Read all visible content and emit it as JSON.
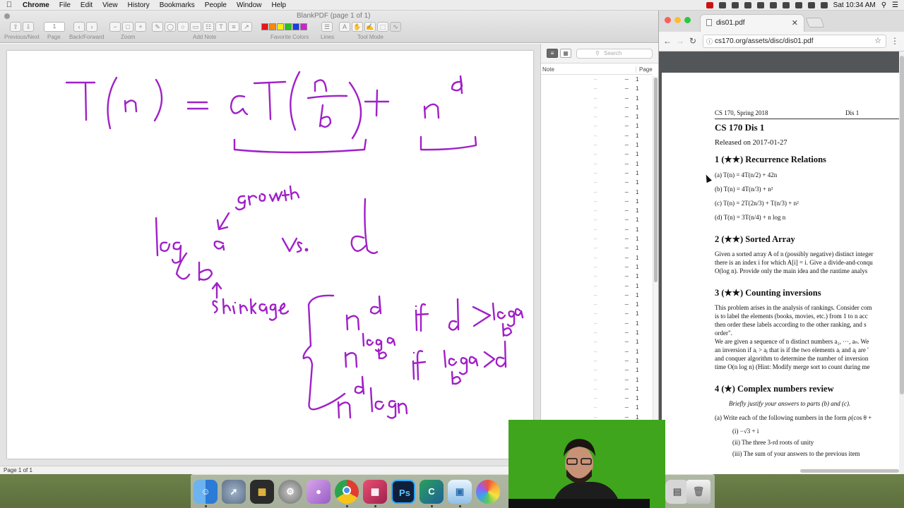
{
  "menubar": {
    "app": "Chrome",
    "items": [
      "File",
      "Edit",
      "View",
      "History",
      "Bookmarks",
      "People",
      "Window",
      "Help"
    ],
    "clock": "Sat 10:34 AM"
  },
  "preview": {
    "window_title": "BlankPDF (page 1 of 1)",
    "page_number": "1",
    "labels": {
      "prev_next": "Previous/Next",
      "page": "Page",
      "back_forward": "Back/Forward",
      "zoom": "Zoom",
      "add_note": "Add Note",
      "favorite_colors": "Favorite Colors",
      "lines": "Lines",
      "tool_mode": "Tool Mode"
    },
    "favorite_colors": [
      "#e8151b",
      "#ef8a13",
      "#f5ee16",
      "#26c124",
      "#1b3fe0",
      "#d21fd2"
    ],
    "status": "Page 1 of 1",
    "ink_color": "#a020c8"
  },
  "notes": {
    "search_placeholder": "Search",
    "col_note": "Note",
    "col_page": "Page",
    "row_page": "1"
  },
  "chrome": {
    "tab_title": "dis01.pdf",
    "url": "cs170.org/assets/disc/dis01.pdf"
  },
  "pdf": {
    "header_left": "CS 170, Spring 2018",
    "header_right": "Dis 1",
    "title": "CS 170 Dis 1",
    "released": "Released on 2017-01-27",
    "sec1": "1   (★★) Recurrence Relations",
    "sec1_items": [
      "(a)  T(n) = 4T(n/2) + 42n",
      "(b)  T(n) = 4T(n/3) + n²",
      "(c)  T(n) = 2T(2n/3) + T(n/3) + n²",
      "(d)  T(n) = 3T(n/4) + n log n"
    ],
    "sec2": "2   (★★) Sorted Array",
    "sec2_body": [
      "Given a sorted array A of n (possibly negative) distinct integer",
      "there is an index i for which A[i] = i. Give a divide-and-conqu",
      "O(log n). Provide only the main idea and the runtime analys"
    ],
    "sec3": "3   (★★) Counting inversions",
    "sec3_body": [
      "This problem arises in the analysis of rankings. Consider com",
      "is to label the elements (books, movies, etc.) from 1 to n acc",
      "then order these labels according to the other ranking, and s",
      "order\".",
      "We are given a sequence of n distinct numbers a₁, ···, aₙ. We",
      "an inversion if aᵢ > aⱼ that is if the two elements aᵢ and aⱼ are '",
      "and conquer algorithm to determine the number of inversion",
      "time O(n log n) (Hint: Modify merge sort to count during me"
    ],
    "sec4": "4   (★) Complex numbers review",
    "sec4_intro": "Briefly justify your answers to parts (b) and (c).",
    "sec4_a": "(a)  Write each of the following numbers in the form ρ(cos θ +",
    "sec4_sub": [
      "(i)   −√3 + i",
      "(ii)  The three 3-rd roots of unity",
      "(iii)  The sum of your answers to the previous item"
    ]
  },
  "dock": {
    "apps": [
      "finder-icon",
      "launchpad-icon",
      "photo-booth-icon",
      "system-preferences-icon",
      "app-icon",
      "chrome-icon",
      "photo-icon",
      "photoshop-icon",
      "clion-icon",
      "preview-icon",
      "photos-icon",
      "trash-icon"
    ],
    "photoshop_label": "Ps",
    "clion_label": "C"
  }
}
